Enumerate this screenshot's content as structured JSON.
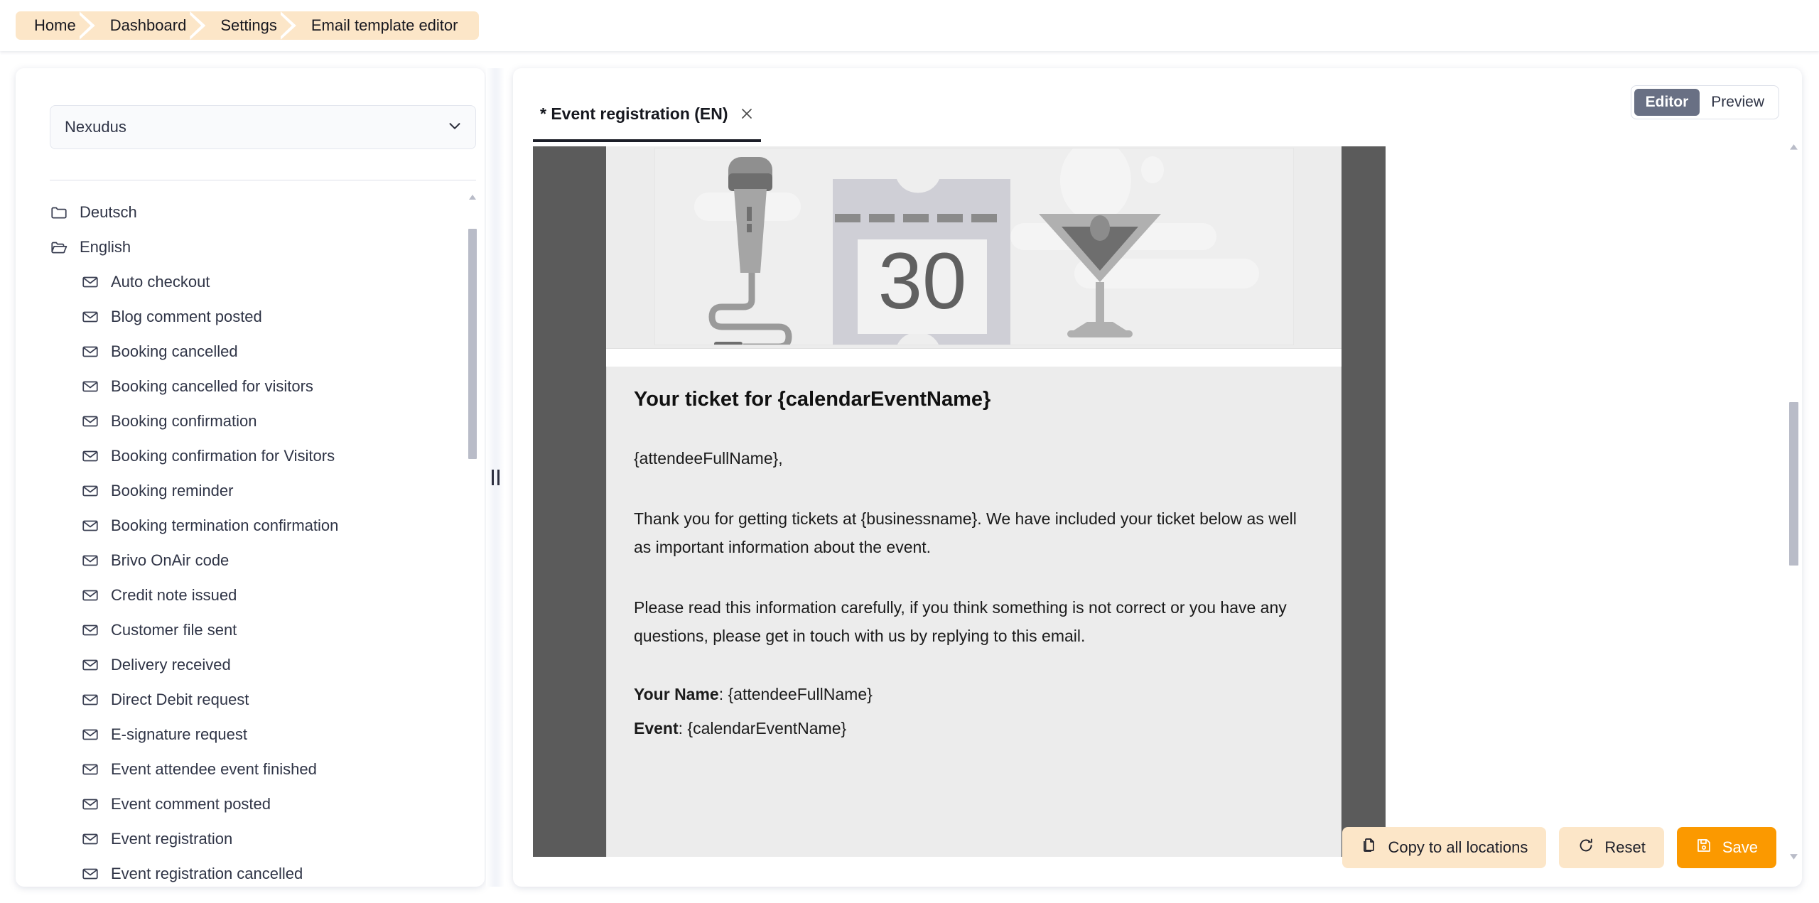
{
  "breadcrumb": {
    "items": [
      {
        "label": "Home"
      },
      {
        "label": "Dashboard"
      },
      {
        "label": "Settings"
      },
      {
        "label": "Email template editor"
      }
    ]
  },
  "sidebar": {
    "business_select": {
      "value": "Nexudus",
      "icon": "chevron-down-icon"
    },
    "tree": [
      {
        "label": "Deutsch",
        "icon": "folder-closed-icon",
        "level": 0
      },
      {
        "label": "English",
        "icon": "folder-open-icon",
        "level": 0
      },
      {
        "label": "Auto checkout",
        "icon": "envelope-icon",
        "level": 1
      },
      {
        "label": "Blog comment posted",
        "icon": "envelope-icon",
        "level": 1
      },
      {
        "label": "Booking cancelled",
        "icon": "envelope-icon",
        "level": 1
      },
      {
        "label": "Booking cancelled for visitors",
        "icon": "envelope-icon",
        "level": 1
      },
      {
        "label": "Booking confirmation",
        "icon": "envelope-icon",
        "level": 1
      },
      {
        "label": "Booking confirmation for Visitors",
        "icon": "envelope-icon",
        "level": 1
      },
      {
        "label": "Booking reminder",
        "icon": "envelope-icon",
        "level": 1
      },
      {
        "label": "Booking termination confirmation",
        "icon": "envelope-icon",
        "level": 1
      },
      {
        "label": "Brivo OnAir code",
        "icon": "envelope-icon",
        "level": 1
      },
      {
        "label": "Credit note issued",
        "icon": "envelope-icon",
        "level": 1
      },
      {
        "label": "Customer file sent",
        "icon": "envelope-icon",
        "level": 1
      },
      {
        "label": "Delivery received",
        "icon": "envelope-icon",
        "level": 1
      },
      {
        "label": "Direct Debit request",
        "icon": "envelope-icon",
        "level": 1
      },
      {
        "label": "E-signature request",
        "icon": "envelope-icon",
        "level": 1
      },
      {
        "label": "Event attendee event finished",
        "icon": "envelope-icon",
        "level": 1
      },
      {
        "label": "Event comment posted",
        "icon": "envelope-icon",
        "level": 1
      },
      {
        "label": "Event registration",
        "icon": "envelope-icon",
        "level": 1
      },
      {
        "label": "Event registration cancelled",
        "icon": "envelope-icon",
        "level": 1
      }
    ]
  },
  "editor": {
    "tab": {
      "title": "* Event registration (EN)",
      "close_icon": "close-icon"
    },
    "mode": {
      "editor_label": "Editor",
      "preview_label": "Preview",
      "active": "Editor"
    },
    "email": {
      "hero_ticket_number": "30",
      "heading": "Your ticket for {calendarEventName}",
      "greeting": "{attendeeFullName},",
      "paragraph_1": "Thank you for getting tickets at {businessname}. We have included your ticket below as well as important information about the event.",
      "paragraph_2": "Please read this information carefully, if you think something is not correct or you have any questions, please get in touch with us by replying to this email.",
      "field_name_label": "Your Name",
      "field_name_value": ": {attendeeFullName}",
      "field_event_label": "Event",
      "field_event_value": ": {calendarEventName}"
    }
  },
  "footer": {
    "copy_label": "Copy to all locations",
    "reset_label": "Reset",
    "save_label": "Save"
  },
  "colors": {
    "breadcrumb_bg": "#fce6c8",
    "accent_orange": "#fb9900",
    "toggle_active": "#697084",
    "canvas_backdrop": "#5b5b5b",
    "email_bg": "#ececec"
  }
}
